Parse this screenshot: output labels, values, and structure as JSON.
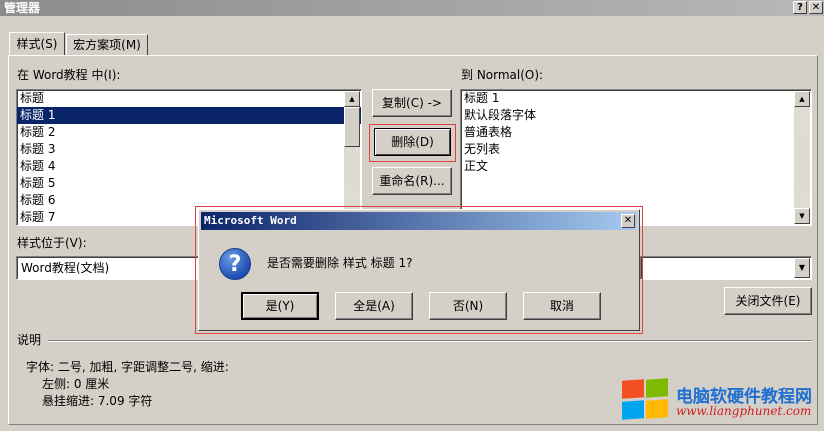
{
  "window": {
    "title": "管理器",
    "help_btn": "?",
    "close_btn": "✕"
  },
  "tabs": [
    {
      "label": "样式(S)"
    },
    {
      "label": "宏方案项(M)"
    }
  ],
  "left": {
    "label": "在 Word教程 中(I):",
    "items": [
      "标题",
      "标题 1",
      "标题 2",
      "标题 3",
      "标题 4",
      "标题 5",
      "标题 6",
      "标题 7"
    ],
    "selected_index": 1,
    "location_label": "样式位于(V):",
    "location_value": "Word教程(文档)"
  },
  "right": {
    "label": "到 Normal(O):",
    "items": [
      "标题 1",
      "默认段落字体",
      "普通表格",
      "无列表",
      "正文"
    ]
  },
  "buttons": {
    "copy": "复制(C) ->",
    "delete": "删除(D)",
    "rename": "重命名(R)...",
    "close_file": "关闭文件(E)"
  },
  "description": {
    "label": "说明",
    "line1": "字体: 二号, 加粗, 字距调整二号, 缩进:",
    "line2": "左侧:  0 厘米",
    "line3": "悬挂缩进: 7.09 字符"
  },
  "dialog": {
    "title": "Microsoft Word",
    "close_btn": "✕",
    "icon": "question-icon",
    "message": "是否需要删除 样式 标题 1?",
    "yes": "是(Y)",
    "yes_all": "全是(A)",
    "no": "否(N)",
    "cancel": "取消"
  },
  "watermark": {
    "text": "电脑软硬件教程网",
    "url": "www.liangphunet.com"
  },
  "colors": {
    "selection": "#0a246a",
    "highlight_box": "#e04040",
    "dialog_title": "#0a246a"
  }
}
